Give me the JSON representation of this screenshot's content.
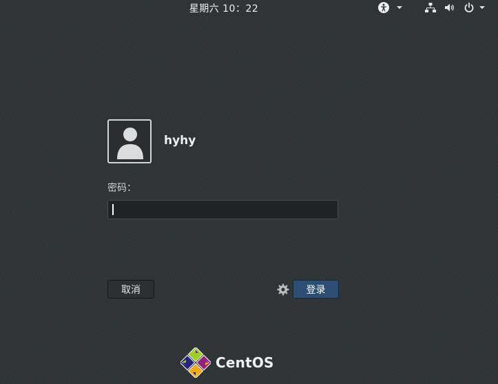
{
  "topbar": {
    "clock": "星期六 10：22",
    "accessibility_icon": "accessibility-icon",
    "network_icon": "network-wired-icon",
    "volume_icon": "volume-icon",
    "power_icon": "power-icon"
  },
  "login": {
    "username": "hyhy",
    "password_label": "密码：",
    "password_value": "",
    "cancel_label": "取消",
    "login_label": "登录",
    "settings_icon": "gear-icon"
  },
  "brand": {
    "name": "CentOS",
    "logo_colors": [
      "#9ccd2a",
      "#932279",
      "#efa724",
      "#262577"
    ]
  },
  "colors": {
    "background": "#2f3436",
    "accent": "#2c4e73",
    "text": "#e6e6e6"
  }
}
